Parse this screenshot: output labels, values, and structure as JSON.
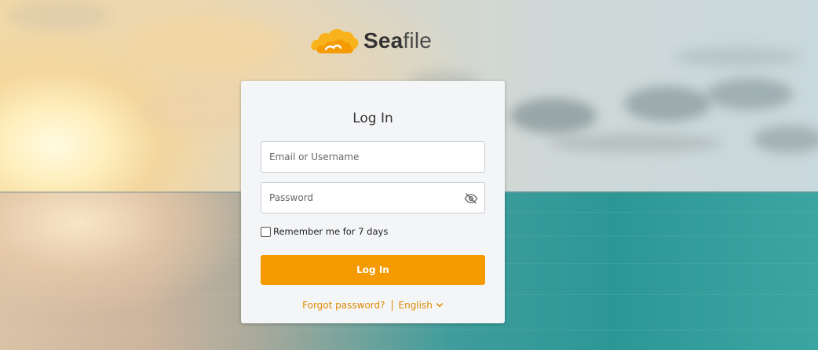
{
  "brand": {
    "name_bold": "Sea",
    "name_rest": "file"
  },
  "login": {
    "title": "Log In",
    "username_placeholder": "Email or Username",
    "password_placeholder": "Password",
    "remember_label": "Remember me for 7 days",
    "submit_label": "Log In",
    "forgot_label": "Forgot password?",
    "language_label": "English"
  },
  "colors": {
    "accent": "#f59a00",
    "link": "#e08a00"
  },
  "icons": {
    "password_toggle": "eye-off-icon",
    "language_dropdown": "chevron-down-icon"
  }
}
